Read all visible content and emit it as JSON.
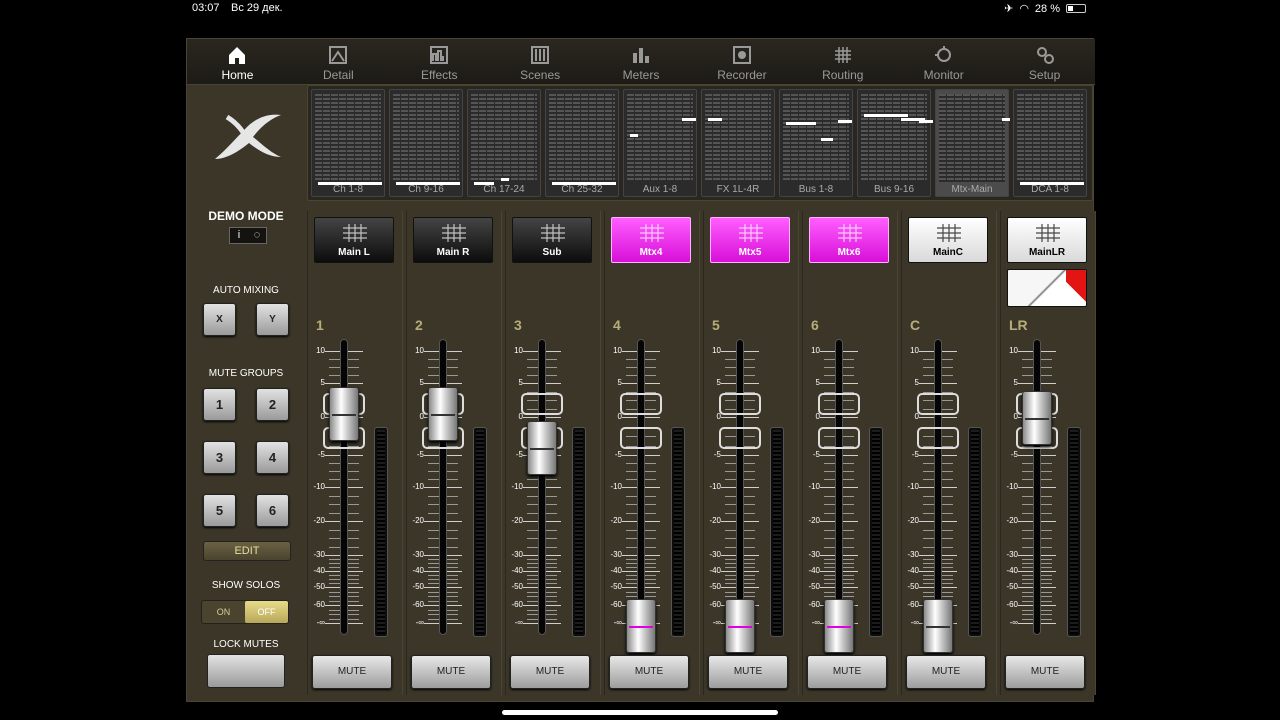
{
  "status": {
    "time": "03:07",
    "date": "Вс 29 дек.",
    "battery": "28 %"
  },
  "nav": [
    {
      "label": "Home",
      "icon": "home-icon",
      "active": true
    },
    {
      "label": "Detail",
      "icon": "detail-icon"
    },
    {
      "label": "Effects",
      "icon": "effects-icon"
    },
    {
      "label": "Scenes",
      "icon": "scenes-icon"
    },
    {
      "label": "Meters",
      "icon": "meters-icon"
    },
    {
      "label": "Recorder",
      "icon": "recorder-icon"
    },
    {
      "label": "Routing",
      "icon": "routing-icon"
    },
    {
      "label": "Monitor",
      "icon": "monitor-icon"
    },
    {
      "label": "Setup",
      "icon": "setup-icon"
    }
  ],
  "left": {
    "mode": "DEMO MODE",
    "info_label": "i",
    "auto_mixing": {
      "title": "AUTO MIXING",
      "x": "X",
      "y": "Y"
    },
    "mute_groups": {
      "title": "MUTE GROUPS",
      "buttons": [
        "1",
        "2",
        "3",
        "4",
        "5",
        "6"
      ]
    },
    "edit": "EDIT",
    "show_solos": {
      "title": "SHOW SOLOS",
      "on": "ON",
      "off": "OFF"
    },
    "lock_mutes": {
      "title": "LOCK MUTES"
    }
  },
  "meter_banks": [
    "Ch 1-8",
    "Ch 9-16",
    "Ch 17-24",
    "Ch 25-32",
    "Aux 1-8",
    "FX 1L-4R",
    "Bus 1-8",
    "Bus 9-16",
    "Mtx-Main",
    "DCA 1-8"
  ],
  "scale": [
    "10",
    "5",
    "0",
    "-5",
    "-10",
    "-20",
    "-30",
    "-40",
    "-50",
    "-60",
    "-∞"
  ],
  "strips": [
    {
      "num": "1",
      "name": "Main L",
      "style": "black",
      "mute": "MUTE"
    },
    {
      "num": "2",
      "name": "Main R",
      "style": "black",
      "mute": "MUTE"
    },
    {
      "num": "3",
      "name": "Sub",
      "style": "black",
      "mute": "MUTE"
    },
    {
      "num": "4",
      "name": "Mtx4",
      "style": "magenta",
      "mute": "MUTE"
    },
    {
      "num": "5",
      "name": "Mtx5",
      "style": "magenta",
      "mute": "MUTE"
    },
    {
      "num": "6",
      "name": "Mtx6",
      "style": "magenta",
      "mute": "MUTE"
    },
    {
      "num": "C",
      "name": "MainC",
      "style": "white",
      "mute": "MUTE"
    },
    {
      "num": "LR",
      "name": "MainLR",
      "style": "white",
      "mute": "MUTE"
    }
  ],
  "colors": {
    "panel": "#3b3628",
    "magenta": "#ff3dff",
    "accent_text": "#b8ad7a"
  }
}
